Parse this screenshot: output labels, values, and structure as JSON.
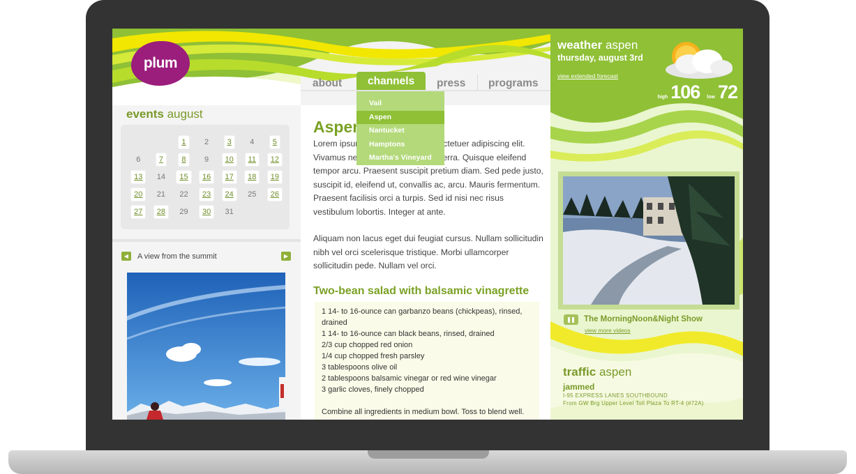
{
  "site": {
    "logo_text": "plum"
  },
  "events": {
    "title_bold": "events",
    "title_rest": " august",
    "days": [
      {
        "d": "",
        "ev": false
      },
      {
        "d": "",
        "ev": false
      },
      {
        "d": "1",
        "ev": true
      },
      {
        "d": "2",
        "ev": false
      },
      {
        "d": "3",
        "ev": true
      },
      {
        "d": "4",
        "ev": false
      },
      {
        "d": "5",
        "ev": true
      },
      {
        "d": "6",
        "ev": false
      },
      {
        "d": "7",
        "ev": true
      },
      {
        "d": "8",
        "ev": true
      },
      {
        "d": "9",
        "ev": false
      },
      {
        "d": "10",
        "ev": true
      },
      {
        "d": "11",
        "ev": true
      },
      {
        "d": "12",
        "ev": true
      },
      {
        "d": "13",
        "ev": true
      },
      {
        "d": "14",
        "ev": false
      },
      {
        "d": "15",
        "ev": true
      },
      {
        "d": "16",
        "ev": true
      },
      {
        "d": "17",
        "ev": true
      },
      {
        "d": "18",
        "ev": true
      },
      {
        "d": "19",
        "ev": true
      },
      {
        "d": "20",
        "ev": true
      },
      {
        "d": "21",
        "ev": false
      },
      {
        "d": "22",
        "ev": false
      },
      {
        "d": "23",
        "ev": true
      },
      {
        "d": "24",
        "ev": true
      },
      {
        "d": "25",
        "ev": false
      },
      {
        "d": "26",
        "ev": true
      },
      {
        "d": "27",
        "ev": true
      },
      {
        "d": "28",
        "ev": true
      },
      {
        "d": "29",
        "ev": false
      },
      {
        "d": "30",
        "ev": true
      },
      {
        "d": "31",
        "ev": false
      },
      {
        "d": "",
        "ev": false
      },
      {
        "d": "",
        "ev": false
      }
    ]
  },
  "gallery": {
    "caption": "A view from the summit"
  },
  "nav": {
    "about": "about",
    "channels": "channels",
    "press": "press",
    "programs": "programs"
  },
  "channels_menu": [
    "Vail",
    "Aspen",
    "Nantucket",
    "Hamptons",
    "Martha's Vineyard"
  ],
  "channels_selected": "Aspen",
  "article": {
    "title": "Aspen",
    "p1": "Lorem ipsum dolor sit amet, consectetuer adipiscing elit. Vivamus nec magna. Mauris at viverra. Quisque eleifend tempor arcu. Praesent suscipit pretium diam. Sed pede justo, suscipit id, eleifend ut, convallis ac, arcu. Mauris fermentum. Praesent facilisis orci a turpis. Sed id nisi nec risus vestibulum lobortis. Integer at ante.",
    "p2": "Aliquam non lacus eget dui feugiat cursus. Nullam sollicitudin nibh vel orci scelerisque tristique. Morbi ullamcorper sollicitudin pede. Nullam vel orci.",
    "recipe_title": "Two-bean salad with balsamic vinagrette",
    "recipe_lines": [
      "1 14- to 16-ounce can garbanzo beans (chickpeas), rinsed, drained",
      "1 14- to 16-ounce can black beans, rinsed, drained",
      "2/3 cup chopped red onion",
      "1/4 cup chopped fresh parsley",
      "3 tablespoons olive oil",
      "2 tablespoons balsamic vinegar or red wine vinegar",
      "3 garlic cloves, finely chopped",
      "",
      "Combine all ingredients in medium bowl. Toss to blend well."
    ]
  },
  "weather": {
    "title_bold": "weather",
    "title_rest": " aspen",
    "date": "thursday, august 3rd",
    "forecast_link": "view extended forecast",
    "high_label": "high",
    "high": "106",
    "low_label": "low",
    "low": "72",
    "icon": "partly-cloudy-icon"
  },
  "video": {
    "show_title": "The MorningNoon&Night Show",
    "more_link": "view more videos"
  },
  "traffic": {
    "title_bold": "traffic",
    "title_rest": " aspen",
    "status": "jammed",
    "route": "I-95 EXPRESS LANES SOUTHBOUND",
    "detail": "From GW Brg Upper Level Toll Plaza To RT-4 (#72A)"
  },
  "colors": {
    "brand_green": "#8fc036",
    "brand_plum": "#9b1d7c",
    "accent_yellow": "#f2e700"
  }
}
